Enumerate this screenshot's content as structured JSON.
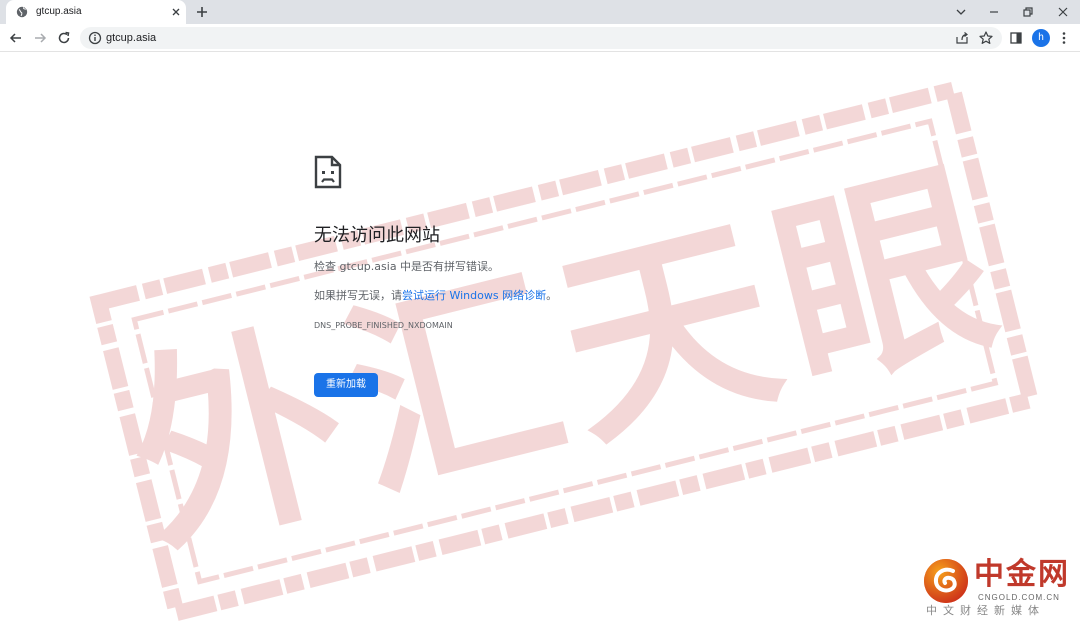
{
  "tab": {
    "title": "gtcup.asia",
    "favicon": "globe-icon"
  },
  "toolbar": {
    "url": "gtcup.asia",
    "avatar_letter": "h"
  },
  "error": {
    "heading": "无法访问此网站",
    "line1": "检查 gtcup.asia 中是否有拼写错误。",
    "line2_prefix": "如果拼写无误，请",
    "line2_link": "尝试运行 Windows 网络诊断",
    "line2_suffix": "。",
    "code": "DNS_PROBE_FINISHED_NXDOMAIN",
    "reload_label": "重新加载"
  },
  "watermark": {
    "text": "外汇天眼",
    "color": "#e8a6a6"
  },
  "logo": {
    "name": "中金网",
    "domain": "CNGOLD.COM.CN",
    "tagline": "中文财经新媒体",
    "color": "#c0392b"
  }
}
